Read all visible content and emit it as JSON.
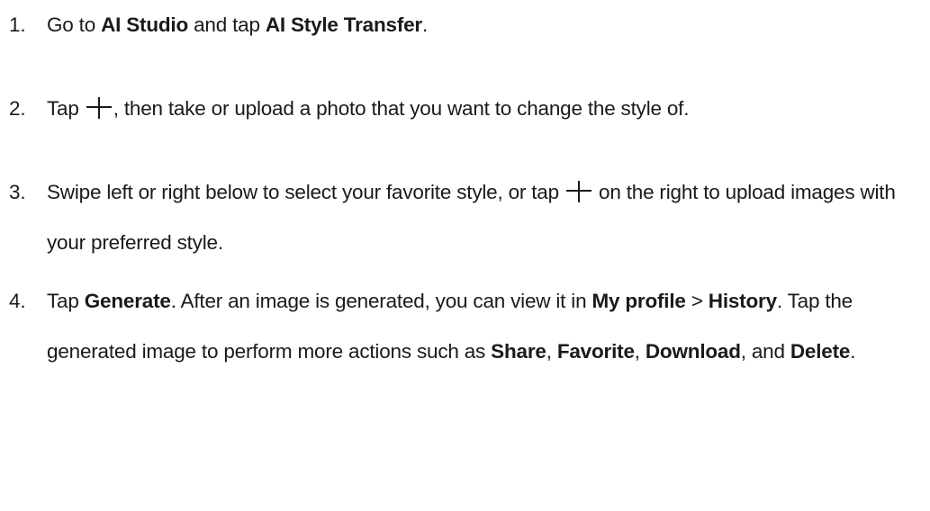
{
  "steps": [
    {
      "number": "1.",
      "parts": [
        "Go to ",
        "AI Studio",
        " and tap ",
        "AI Style Transfer",
        "."
      ]
    },
    {
      "number": "2.",
      "parts": [
        "Tap ",
        ", then take or upload a photo that you want to change the style of."
      ],
      "icon": "plus-icon"
    },
    {
      "number": "3.",
      "parts": [
        "Swipe left or right below to select your favorite style, or tap ",
        " on the right to upload images with your preferred style."
      ],
      "icon": "plus-icon"
    },
    {
      "number": "4.",
      "parts": [
        "Tap ",
        "Generate",
        ". After an image is generated, you can view it in ",
        "My profile",
        " > ",
        "History",
        ". Tap the generated image to perform more actions such as ",
        "Share",
        ", ",
        "Favorite",
        ", ",
        "Download",
        ", and ",
        "Delete",
        "."
      ]
    }
  ]
}
